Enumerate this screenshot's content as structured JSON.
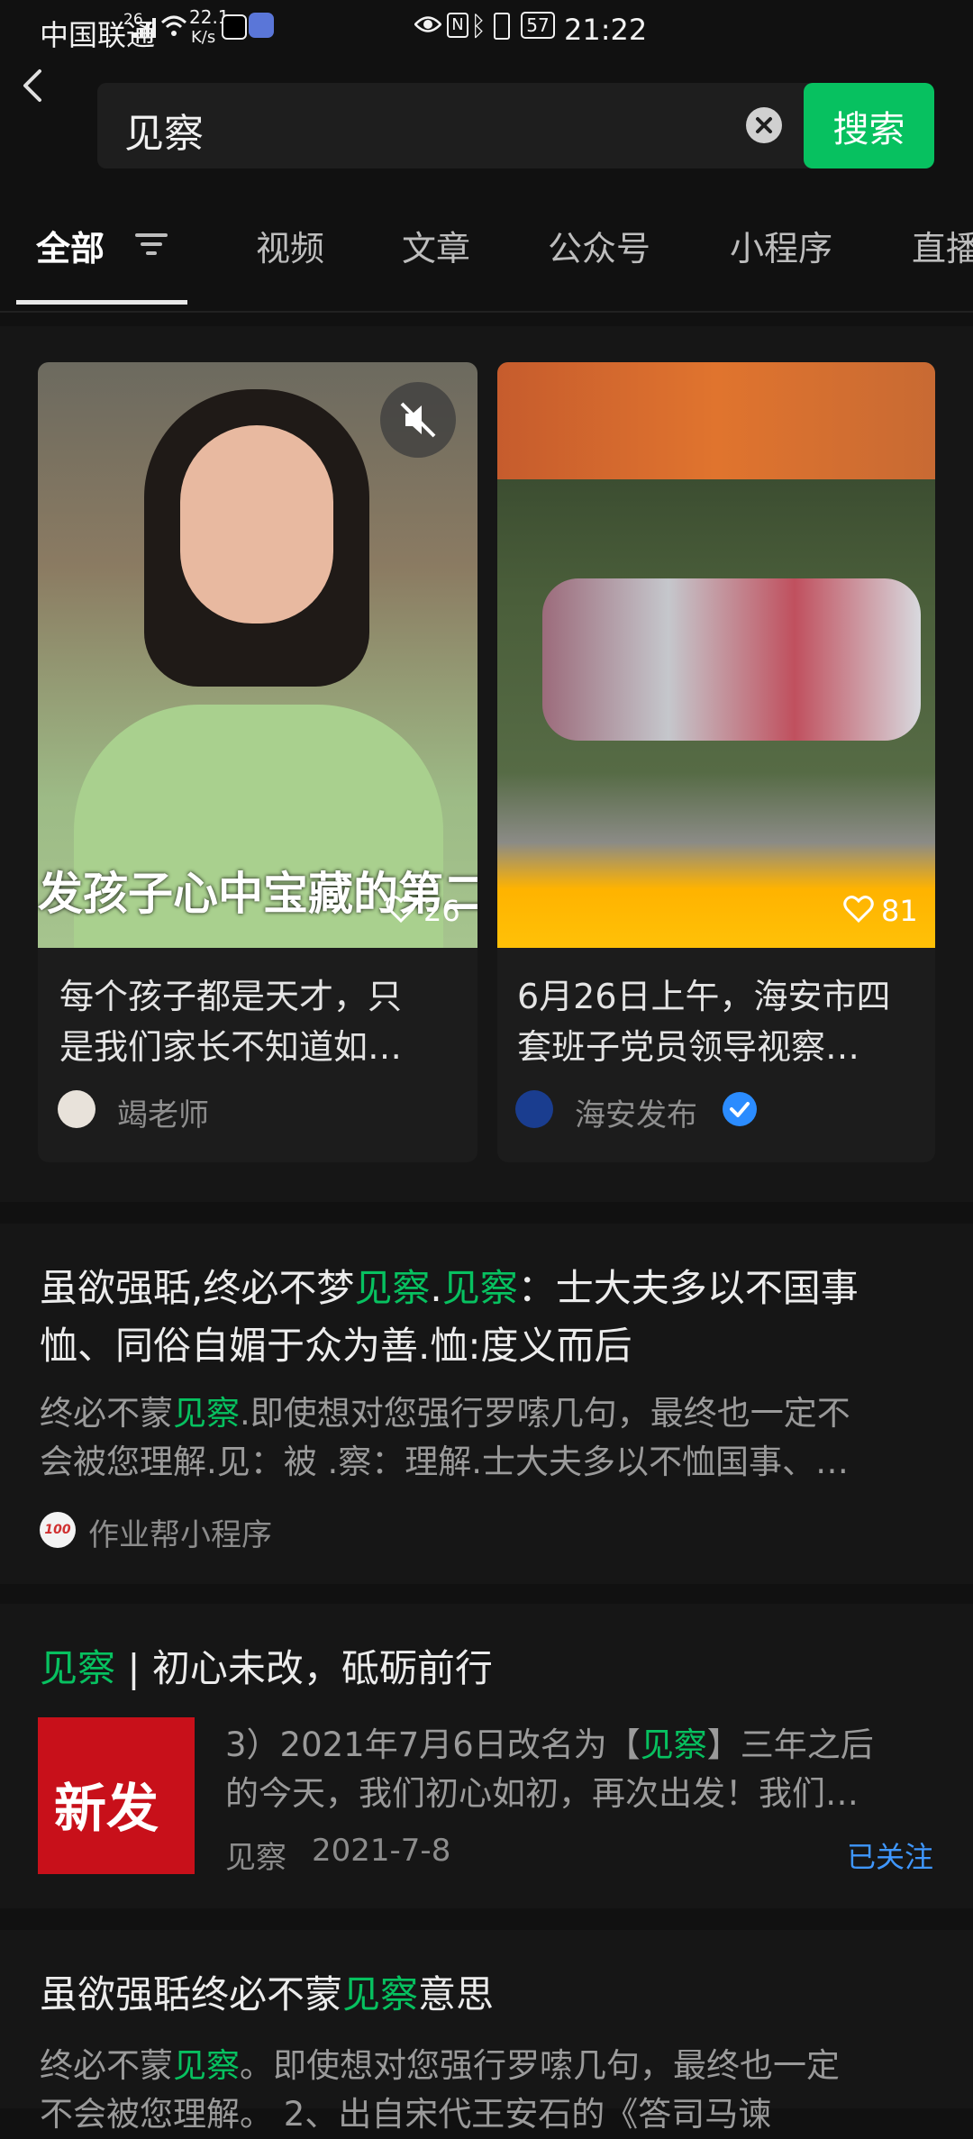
{
  "status_bar": {
    "carrier": "中国联通",
    "network_badge": "26",
    "net_speed_value": "22.1",
    "net_speed_unit": "K/s",
    "battery": "57",
    "time": "21:22"
  },
  "search": {
    "query": "见察",
    "button_label": "搜索"
  },
  "tabs": [
    {
      "label": "全部"
    },
    {
      "label": "视频"
    },
    {
      "label": "文章"
    },
    {
      "label": "公众号"
    },
    {
      "label": "小程序"
    },
    {
      "label": "直播"
    }
  ],
  "videos": [
    {
      "overlay_caption": "发孩子心中宝藏的第二",
      "likes": "26",
      "title_line1": "每个孩子都是天才，只",
      "title_line2": "是我们家长不知道如…",
      "author": "竭老师"
    },
    {
      "likes": "81",
      "title_line1": "6月26日上午，海安市四",
      "title_line2": "套班子党员领导视察…",
      "author": "海安发布"
    }
  ],
  "result1": {
    "title_l1_a": "虽欲强聒,终必不梦",
    "title_l1_hl1": "见察",
    "title_l1_b": ".",
    "title_l1_hl2": "见察",
    "title_l1_c": "：士大夫多以不国事",
    "title_l2": "恤、同俗自媚于众为善.恤:度义而后",
    "desc_l1_a": "终必不蒙",
    "desc_l1_hl": "见察",
    "desc_l1_b": ".即使想对您强行罗嗦几句，最终也一定不",
    "desc_l2": "会被您理解.见：被 .察：理解.士大夫多以不恤国事、…",
    "source": "作业帮小程序",
    "source_icon": "100"
  },
  "result2": {
    "title_hl": "见察",
    "title_rest": " | 初心未改，砥砺前行",
    "thumb_text": "新发",
    "desc_l1_a": "3）2021年7月6日改名为【",
    "desc_l1_hl": "见察",
    "desc_l1_b": "】三年之后",
    "desc_l2": "的今天，我们初心如初，再次出发！我们…",
    "account": "见察",
    "date": "2021-7-8",
    "follow_status": "已关注"
  },
  "result3": {
    "title_a": "虽欲强聒终必不蒙",
    "title_hl": "见察",
    "title_b": "意思",
    "desc_l1_a": "终必不蒙",
    "desc_l1_hl": "见察",
    "desc_l1_b": "。即使想对您强行罗嗦几句，最终也一定",
    "desc_l2": "不会被您理解。 2、出自宋代王安石的《答司马谏"
  },
  "colors": {
    "accent": "#07c160",
    "background": "#111111",
    "card": "#1c1c1c",
    "link_blue": "#3f97ff",
    "verified_blue": "#2b8cff"
  }
}
